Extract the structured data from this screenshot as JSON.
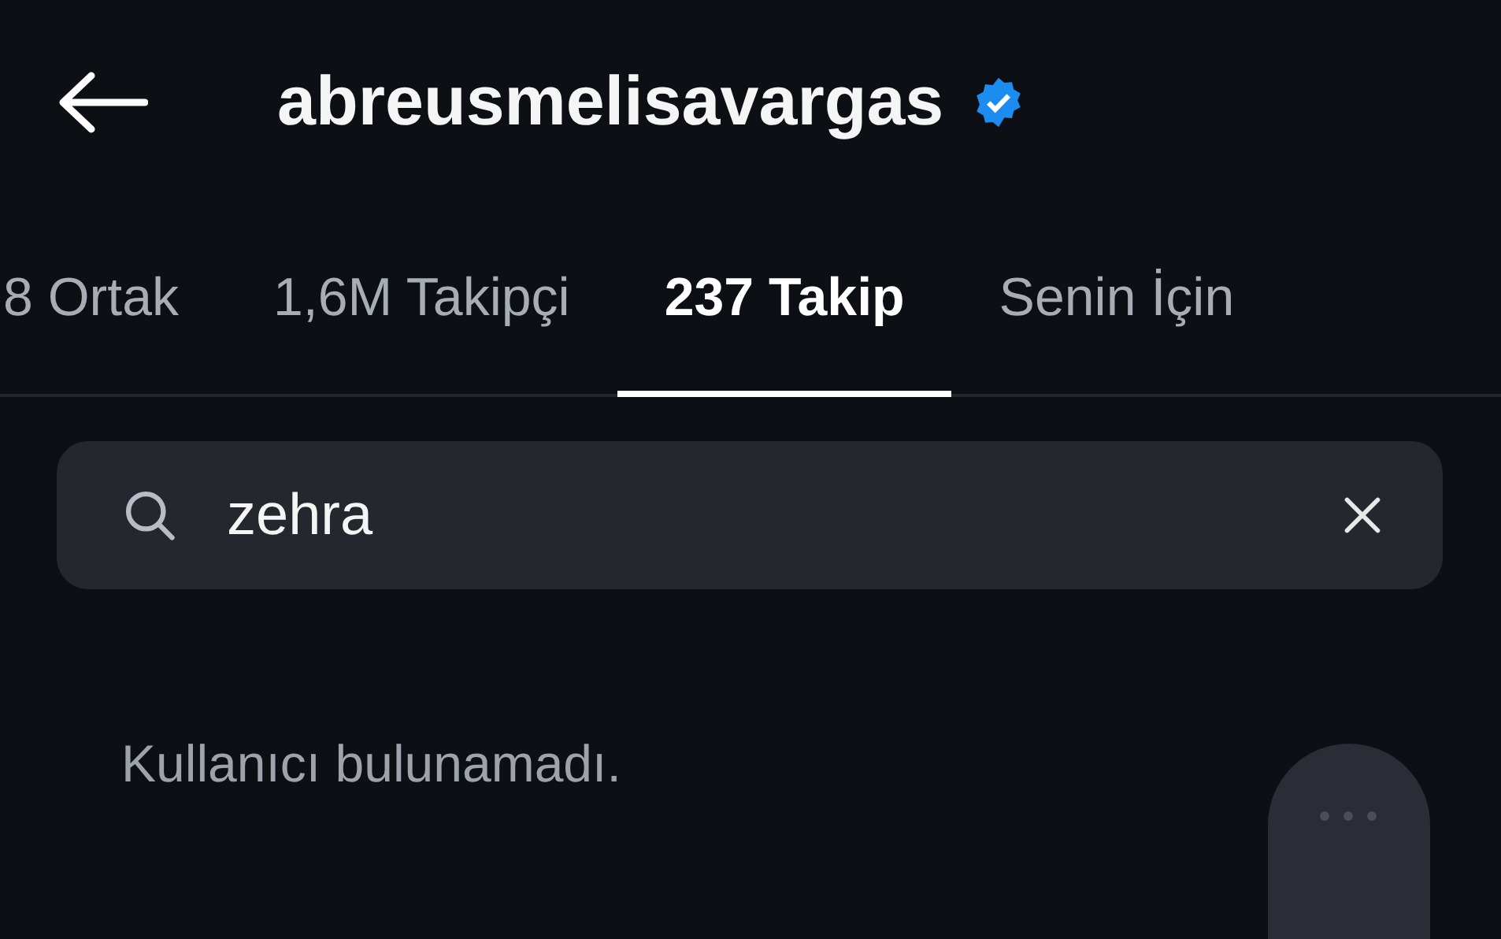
{
  "header": {
    "title": "abreusmelisavargas",
    "verified": true
  },
  "tabs": [
    {
      "label": "8 Ortak",
      "selected": false
    },
    {
      "label": "1,6M Takipçi",
      "selected": false
    },
    {
      "label": "237 Takip",
      "selected": true
    },
    {
      "label": "Senin İçin",
      "selected": false
    }
  ],
  "search": {
    "value": "zehra"
  },
  "empty_message": "Kullanıcı bulunamadı."
}
